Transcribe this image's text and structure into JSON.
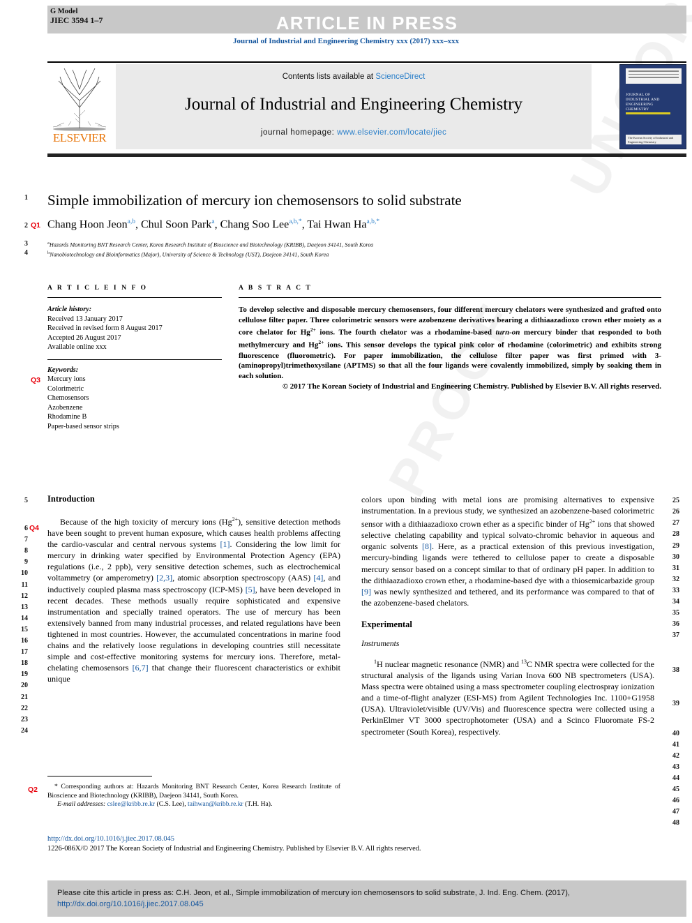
{
  "header": {
    "g_model": "G Model",
    "manuscript_id": "JIEC 3594 1–7",
    "article_in_press": "ARTICLE IN PRESS",
    "journal_citation": "Journal of Industrial and Engineering Chemistry xxx (2017) xxx–xxx"
  },
  "masthead": {
    "contents_prefix": "Contents lists available at ",
    "sciencedirect": "ScienceDirect",
    "journal_title": "Journal of Industrial and Engineering Chemistry",
    "homepage_prefix": "journal homepage: ",
    "homepage_url": "www.elsevier.com/locate/jiec",
    "publisher": "ELSEVIER",
    "cover_lines": [
      "JOURNAL OF",
      "INDUSTRIAL AND",
      "ENGINEERING",
      "CHEMISTRY"
    ],
    "cover_footer": "The Korean Society of Industrial and Engineering Chemistry"
  },
  "article": {
    "title": "Simple immobilization of mercury ion chemosensors to solid substrate",
    "authors": [
      {
        "name": "Chang Hoon Jeon",
        "sup": "a,b"
      },
      {
        "name": "Chul Soon Park",
        "sup": "a"
      },
      {
        "name": "Chang Soo Lee",
        "sup": "a,b,*"
      },
      {
        "name": "Tai Hwan Ha",
        "sup": "a,b,*"
      }
    ],
    "affiliations": [
      {
        "marker": "a",
        "text": "Hazards Monitoring BNT Research Center, Korea Research Institute of Bioscience and Biotechnology (KRIBB), Daejeon 34141, South Korea"
      },
      {
        "marker": "b",
        "text": "Nanobiotechnology and Bioinformatics (Major), University of Science & Technology (UST), Daejeon 34141, South Korea"
      }
    ]
  },
  "article_info": {
    "heading": "A R T I C L E   I N F O",
    "history_label": "Article history:",
    "history": [
      "Received 13 January 2017",
      "Received in revised form 8 August 2017",
      "Accepted 26 August 2017",
      "Available online xxx"
    ],
    "keywords_label": "Keywords:",
    "keywords": [
      "Mercury ions",
      "Colorimetric",
      "Chemosensors",
      "Azobenzene",
      "Rhodamine B",
      "Paper-based sensor strips"
    ]
  },
  "abstract": {
    "heading": "A B S T R A C T",
    "body_part1": "To develop selective and disposable mercury chemosensors, four different mercury chelators were synthesized and grafted onto cellulose filter paper. Three colorimetric sensors were azobenzene derivatives bearing a dithiaazadioxo crown ether moiety as a core chelator for Hg",
    "sup1": "2+",
    "body_part2": " ions. The fourth chelator was a rhodamine-based ",
    "italic1": "turn-on",
    "body_part3": " mercury binder that responded to both methylmercury and Hg",
    "sup2": "2+",
    "body_part4": " ions. This sensor develops the typical pink color of rhodamine (colorimetric) and exhibits strong fluorescence (fluorometric). For paper immobilization, the cellulose filter paper was first primed with 3-(aminopropyl)trimethoxysilane (APTMS) so that all the four ligands were covalently immobilized, simply by soaking them in each solution.",
    "copyright": "© 2017 The Korean Society of Industrial and Engineering Chemistry. Published by Elsevier B.V. All rights reserved."
  },
  "sections": {
    "introduction_heading": "Introduction",
    "intro_p1_a": "Because of the high toxicity of mercury ions (Hg",
    "intro_p1_sup": "2+",
    "intro_p1_b": "), sensitive detection methods have been sought to prevent human exposure, which causes health problems affecting the cardio-vascular and central nervous systems ",
    "ref1": "[1]",
    "intro_p1_c": ". Considering the low limit for mercury in drinking water specified by Environmental Protection Agency (EPA) regulations (i.e., 2 ppb), very sensitive detection schemes, such as electrochemical voltammetry (or amperometry) ",
    "ref23": "[2,3]",
    "intro_p1_d": ", atomic absorption spectroscopy (AAS) ",
    "ref4": "[4]",
    "intro_p1_e": ", and inductively coupled plasma mass spectroscopy (ICP-MS) ",
    "ref5": "[5]",
    "intro_p1_f": ", have been developed in recent decades. These methods usually require sophisticated and expensive instrumentation and specially trained operators. The use of mercury has been extensively banned from many industrial processes, and related regulations have been tightened in most countries. However, the accumulated concentrations in marine food chains and the relatively loose regulations in developing countries still necessitate simple and cost-effective monitoring systems for mercury ions. Therefore, metal-chelating chemosensors ",
    "ref67": "[6,7]",
    "intro_p1_g": " that change their fluorescent characteristics or exhibit unique",
    "intro_p2_a": "colors upon binding with metal ions are promising alternatives to expensive instrumentation. In a previous study, we synthesized an azobenzene-based colorimetric sensor with a dithiaazadioxo crown ether as a specific binder of Hg",
    "intro_p2_sup": "2+",
    "intro_p2_b": " ions that showed selective chelating capability and typical solvato-chromic behavior in aqueous and organic solvents ",
    "ref8": "[8]",
    "intro_p2_c": ". Here, as a practical extension of this previous investigation, mercury-binding ligands were tethered to cellulose paper to create a disposable mercury sensor based on a concept similar to that of ordinary pH paper. In addition to the dithiaazadioxo crown ether, a rhodamine-based dye with a thiosemicarbazide group ",
    "ref9": "[9]",
    "intro_p2_d": " was newly synthesized and tethered, and its performance was compared to that of the azobenzene-based chelators.",
    "experimental_heading": "Experimental",
    "instruments_heading": "Instruments",
    "instruments_sup1": "1",
    "instruments_a": "H nuclear magnetic resonance (NMR) and ",
    "instruments_sup2": "13",
    "instruments_b": "C NMR spectra were collected for the structural analysis of the ligands using Varian Inova 600 NB spectrometers (USA). Mass spectra were obtained using a mass spectrometer coupling electrospray ionization and a time-of-flight analyzer (ESI-MS) from Agilent Technologies Inc. 1100+G1958 (USA). Ultraviolet/visible (UV/Vis) and fluorescence spectra were collected using a PerkinElmer VT 3000 spectrophotometer (USA) and a Scinco Fluoromate FS-2 spectrometer (South Korea), respectively."
  },
  "footnotes": {
    "corresponding_marker": "*",
    "corresponding": " Corresponding authors at: Hazards Monitoring BNT Research Center, Korea Research Institute of Bioscience and Biotechnology (KRIBB), Daejeon 34141, South Korea.",
    "email_label": "E-mail addresses:",
    "email1": "cslee@kribb.re.kr",
    "email1_who": " (C.S. Lee), ",
    "email2": "taihwan@kribb.re.kr",
    "email2_who": " (T.H. Ha).",
    "doi_url": "http://dx.doi.org/10.1016/j.jiec.2017.08.045",
    "issn_line": "1226-086X/© 2017 The Korean Society of Industrial and Engineering Chemistry. Published by Elsevier B.V. All rights reserved."
  },
  "cite_box": {
    "text_before": "Please cite this article in press as: C.H. Jeon, et al., Simple immobilization of mercury ion chemosensors to solid substrate, J. Ind. Eng. Chem. (2017), ",
    "link": "http://dx.doi.org/10.1016/j.jiec.2017.08.045"
  },
  "line_numbers": {
    "left_top": [
      "1",
      "2",
      "3",
      "4"
    ],
    "left_body": [
      "5",
      "6",
      "7",
      "8",
      "9",
      "10",
      "11",
      "12",
      "13",
      "14",
      "15",
      "16",
      "17",
      "18",
      "19",
      "20",
      "21",
      "22",
      "23",
      "24"
    ],
    "right_body": [
      "25",
      "26",
      "27",
      "28",
      "29",
      "30",
      "31",
      "32",
      "33",
      "34",
      "35",
      "36",
      "37",
      "38",
      "39",
      "40",
      "41",
      "42",
      "43",
      "44",
      "45",
      "46",
      "47",
      "48"
    ]
  },
  "query_markers": {
    "q1": "Q1",
    "q2": "Q2",
    "q3": "Q3",
    "q4": "Q4"
  },
  "watermark": {
    "line1": "UNCORRECTED",
    "line2": "PROOF"
  },
  "colors": {
    "link_blue": "#15569e",
    "sciencedirect_blue": "#2a7fc9",
    "elsevier_orange": "#e8750a",
    "query_red": "#e8000b",
    "bar_gray": "#c8c8c8",
    "box_gray": "#eaeaea"
  }
}
